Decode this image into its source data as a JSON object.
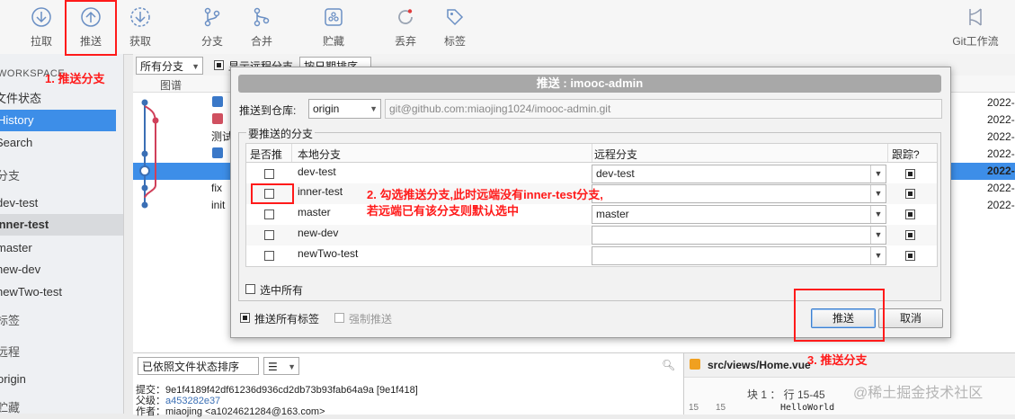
{
  "toolbar": {
    "items": [
      {
        "label": "拉取",
        "icon": "pull-icon"
      },
      {
        "label": "推送",
        "icon": "push-icon"
      },
      {
        "label": "获取",
        "icon": "fetch-icon"
      },
      {
        "label": "分支",
        "icon": "branch-icon"
      },
      {
        "label": "合并",
        "icon": "merge-icon"
      },
      {
        "label": "贮藏",
        "icon": "stash-icon"
      },
      {
        "label": "丢弃",
        "icon": "discard-icon"
      },
      {
        "label": "标签",
        "icon": "tag-icon"
      },
      {
        "label": "Git工作流",
        "icon": "git-flow-icon"
      }
    ]
  },
  "sidebar": {
    "workspace": "WORKSPACE",
    "file_status": "文件状态",
    "history": "History",
    "search": "Search",
    "branches_section": "分支",
    "branches": [
      "dev-test",
      "inner-test",
      "master",
      "new-dev",
      "newTwo-test"
    ],
    "tags_section": "标签",
    "remotes_section": "远程",
    "remotes": [
      "origin"
    ],
    "stash_section": "贮藏"
  },
  "history": {
    "branch_filter": "所有分支",
    "show_remote": "显示远程分支",
    "sort": "按日期排序",
    "col_graph": "图谱",
    "messages": [
      "测试",
      "fix",
      "init"
    ],
    "dates": [
      "2022-",
      "2022-",
      "2022-",
      "2022-",
      "2022-",
      "2022-",
      "2022-"
    ]
  },
  "bottom": {
    "sort_combo": "已依照文件状态排序",
    "commit_label": "提交：",
    "commit_value": "9e1f4189f42df61236d936cd2db73b93fab64a9a [9e1f418]",
    "parent_label": "父级：",
    "parent_value": "a453282e37",
    "author_label": "作者：",
    "author_value": "miaojing <a1024621284@163.com>",
    "file_path": "src/views/Home.vue",
    "hunk_label": "块 1 ： 行 15-45",
    "diff_line_a": "15",
    "diff_line_b": "15",
    "diff_text": "HelloWorld",
    "watermark": "@稀土掘金技术社区"
  },
  "dialog": {
    "title": "推送 : imooc-admin",
    "push_to_repo_label": "推送到仓库:",
    "repo": "origin",
    "repo_url": "git@github.com:miaojing1024/imooc-admin.git",
    "branches_group": "要推送的分支",
    "col_push": "是否推",
    "col_local": "本地分支",
    "col_remote": "远程分支",
    "col_track": "跟踪?",
    "rows": [
      {
        "local": "dev-test",
        "remote": "dev-test",
        "push": false,
        "track": true
      },
      {
        "local": "inner-test",
        "remote": "",
        "push": false,
        "track": true
      },
      {
        "local": "master",
        "remote": "master",
        "push": false,
        "track": true
      },
      {
        "local": "new-dev",
        "remote": "",
        "push": false,
        "track": true
      },
      {
        "local": "newTwo-test",
        "remote": "",
        "push": false,
        "track": true
      }
    ],
    "select_all": "选中所有",
    "push_all_tags": "推送所有标签",
    "force_push": "强制推送",
    "push_button": "推送",
    "cancel_button": "取消"
  },
  "annotations": {
    "step1": "1. 推送分支",
    "step2_line1": "2. 勾选推送分支,此时远端没有inner-test分支,",
    "step2_line2": "若远端已有该分支则默认选中",
    "step3": "3. 推送分支"
  },
  "colors": {
    "accent": "#3d8ee8",
    "annotation": "#ff1a1a"
  }
}
